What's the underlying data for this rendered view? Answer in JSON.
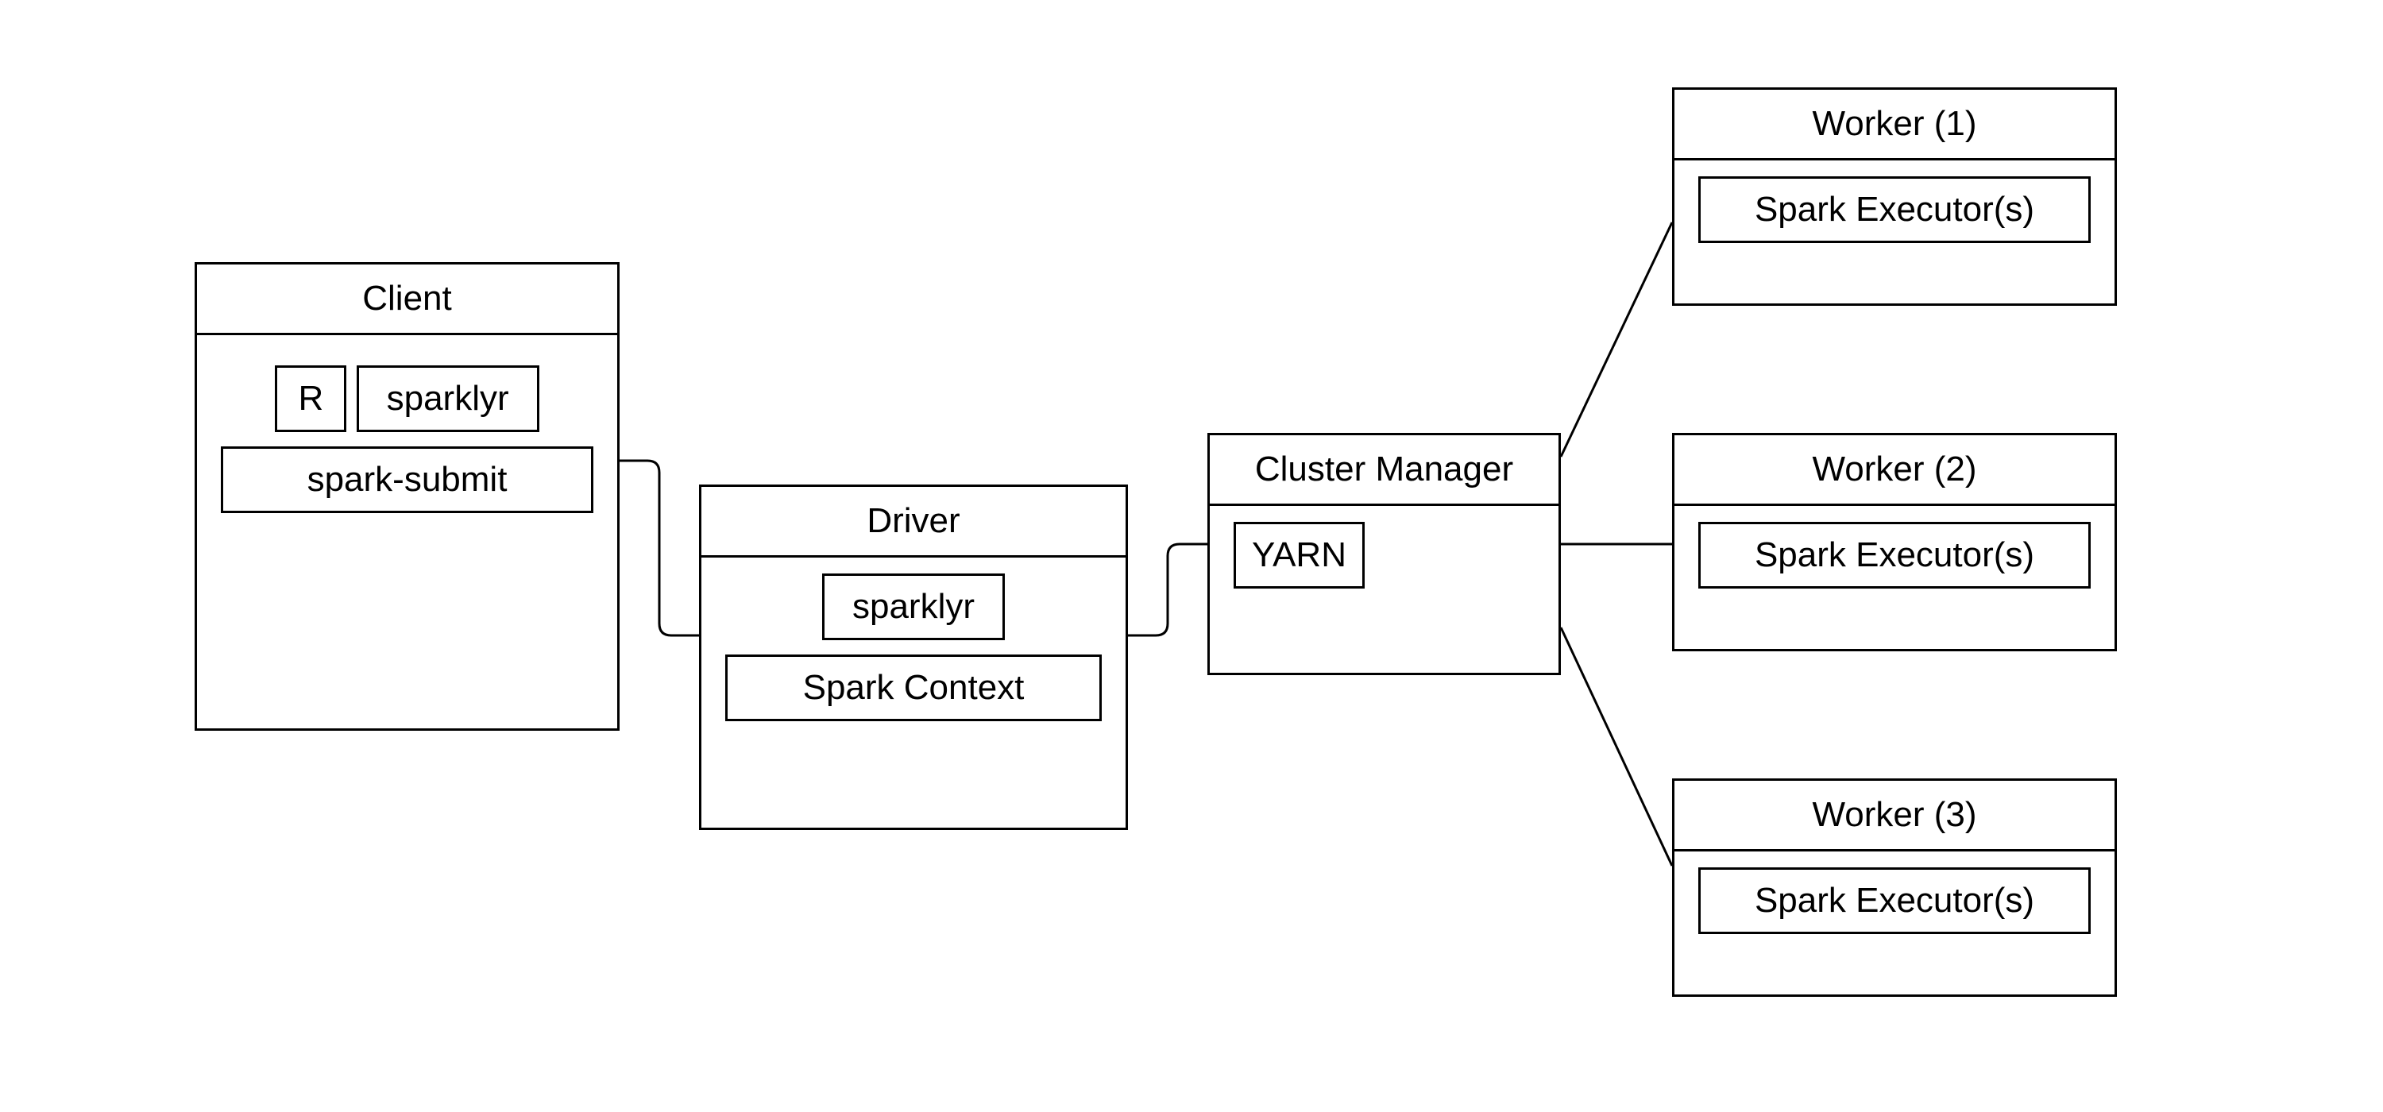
{
  "client": {
    "title": "Client",
    "r": "R",
    "sparklyr": "sparklyr",
    "submit": "spark-submit"
  },
  "driver": {
    "title": "Driver",
    "sparklyr": "sparklyr",
    "context": "Spark Context"
  },
  "cluster": {
    "title": "Cluster Manager",
    "yarn": "YARN"
  },
  "workers": [
    {
      "title": "Worker (1)",
      "exec": "Spark Executor(s)"
    },
    {
      "title": "Worker (2)",
      "exec": "Spark Executor(s)"
    },
    {
      "title": "Worker (3)",
      "exec": "Spark Executor(s)"
    }
  ]
}
